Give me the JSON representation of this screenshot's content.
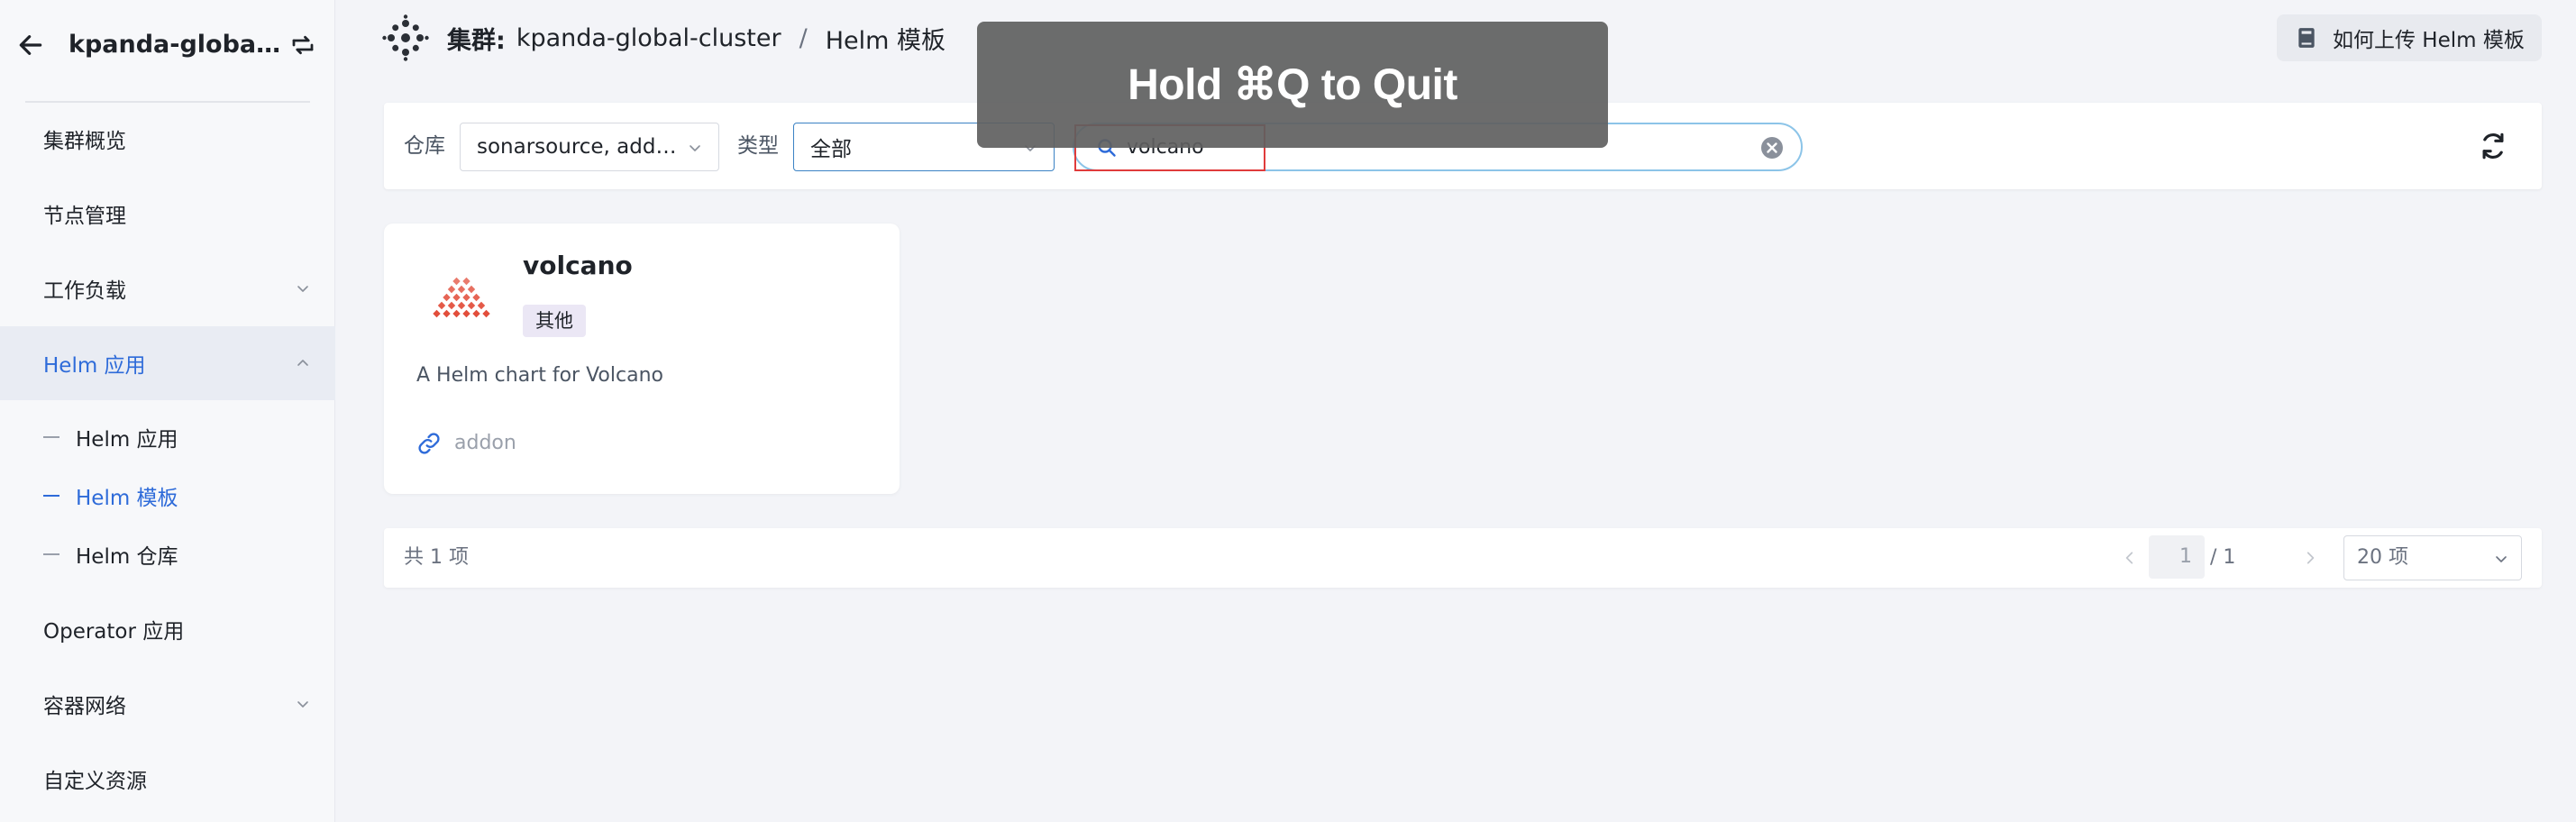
{
  "sidebar": {
    "cluster_title": "kpanda-global-cl...",
    "items": [
      {
        "label": "集群概览"
      },
      {
        "label": "节点管理"
      },
      {
        "label": "工作负载"
      },
      {
        "label": "Helm 应用"
      },
      {
        "label": "Operator 应用"
      },
      {
        "label": "容器网络"
      },
      {
        "label": "自定义资源"
      }
    ],
    "sub_items": [
      {
        "label": "Helm 应用"
      },
      {
        "label": "Helm 模板"
      },
      {
        "label": "Helm 仓库"
      }
    ]
  },
  "header": {
    "cluster_label": "集群:",
    "cluster_name": "kpanda-global-cluster",
    "separator": "/",
    "page": "Helm 模板",
    "doc_button": "如何上传 Helm 模板"
  },
  "filters": {
    "repo_label": "仓库",
    "repo_value": "sonarsource, addo...",
    "type_label": "类型",
    "type_value": "全部",
    "search_value": "volcano"
  },
  "cards": [
    {
      "title": "volcano",
      "tag": "其他",
      "description": "A Helm chart for Volcano",
      "repo": "addon"
    }
  ],
  "pagination": {
    "total": "共 1 项",
    "current": "1",
    "of_total": "/ 1",
    "page_size": "20 项"
  },
  "overlay": {
    "text": "Hold ⌘Q to Quit"
  },
  "colors": {
    "accent": "#2e6bd9",
    "logo_red": "#e0432f"
  }
}
